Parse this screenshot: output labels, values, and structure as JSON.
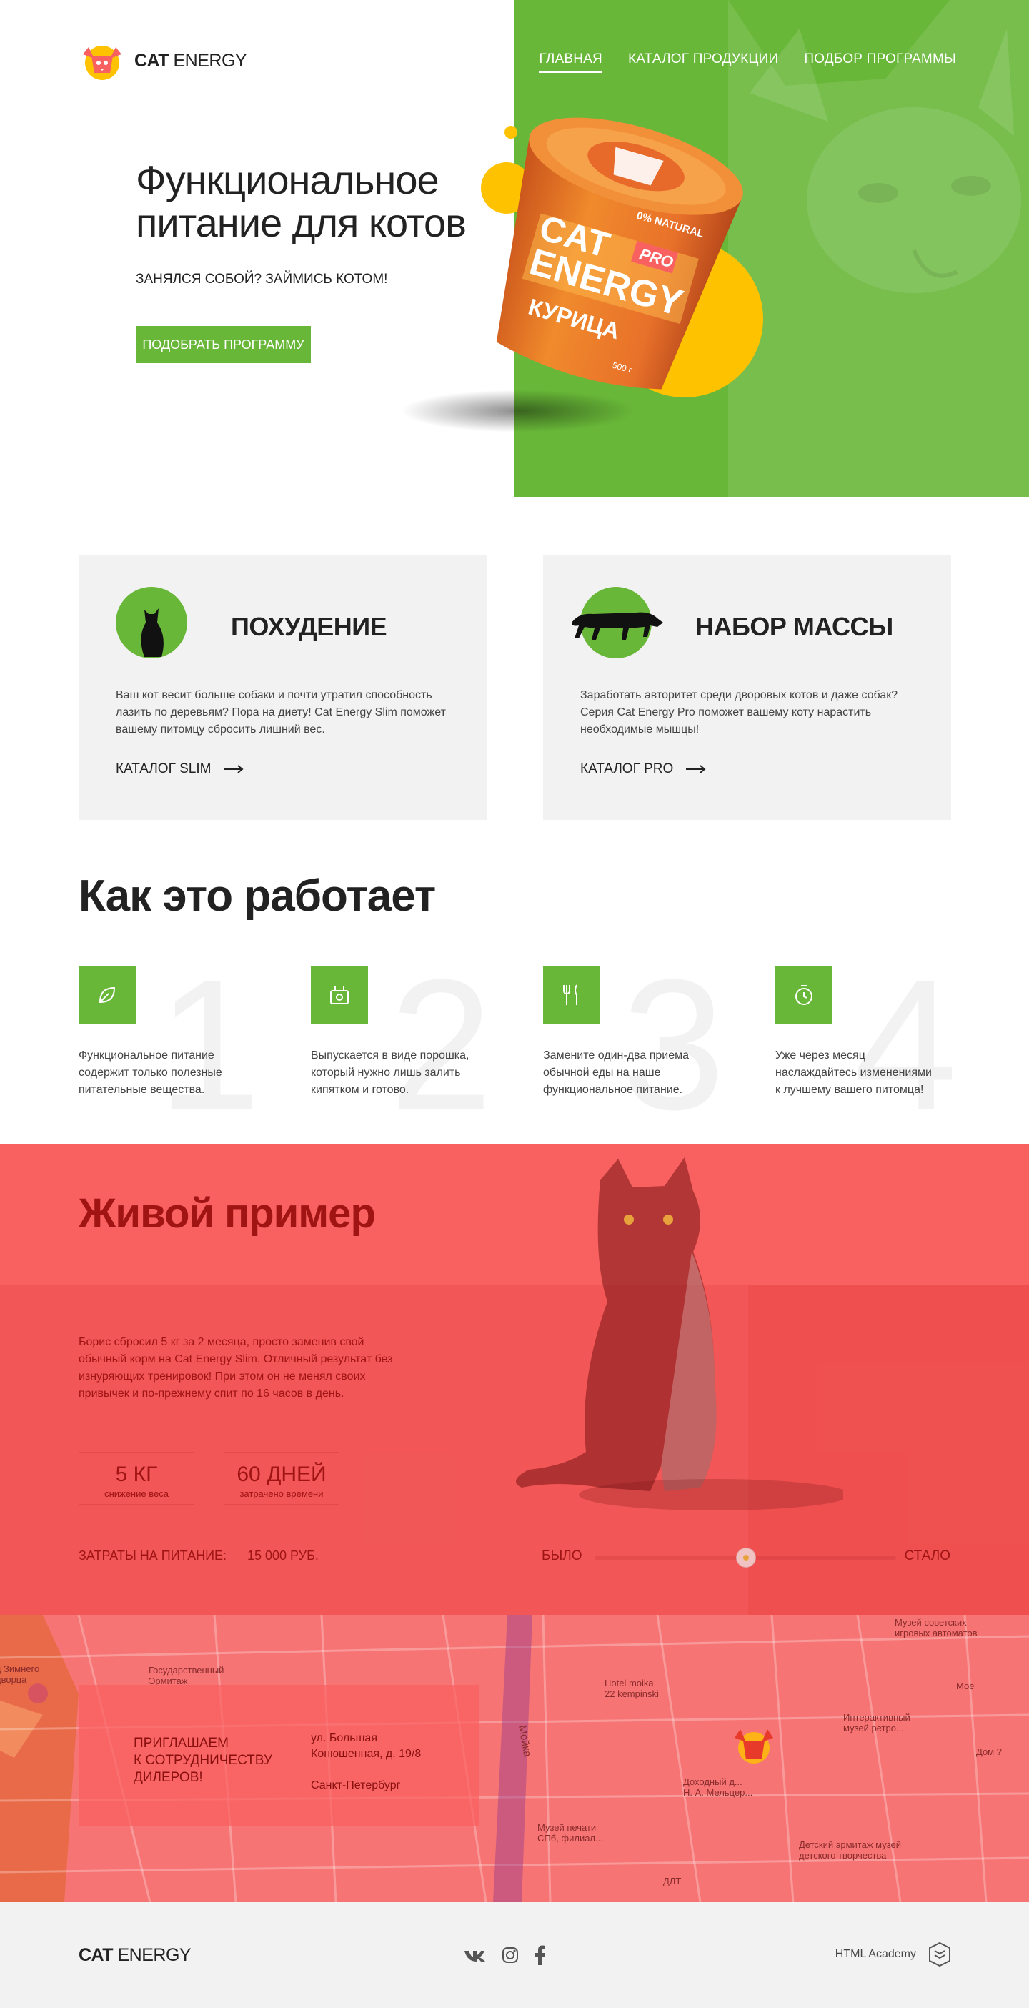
{
  "header": {
    "logo_bold": "CAT",
    "logo_light": "ENERGY",
    "nav": [
      "ГЛАВНАЯ",
      "КАТАЛОГ ПРОДУКЦИИ",
      "ПОДБОР ПРОГРАММЫ"
    ]
  },
  "hero": {
    "title_line1": "Функциональное",
    "title_line2": "питание для котов",
    "subtitle": "ЗАНЯЛСЯ СОБОЙ? ЗАЙМИСЬ КОТОМ!",
    "button": "ПОДОБРАТЬ ПРОГРАММУ",
    "can": {
      "natural": "0% NATURAL",
      "brand1": "CAT",
      "brand2": "ENERGY",
      "pro": "PRO",
      "flavor": "КУРИЦА",
      "weight": "500 г"
    }
  },
  "cards": [
    {
      "title": "ПОХУДЕНИЕ",
      "text": "Ваш кот весит больше собаки и почти утратил способность лазить по деревьям? Пора на диету! Cat Energy Slim поможет вашему питомцу сбросить лишний вес.",
      "link": "КАТАЛОГ SLIM"
    },
    {
      "title": "НАБОР МАССЫ",
      "text": "Заработать авторитет среди дворовых котов и даже собак? Серия Cat Energy Pro поможет вашему коту нарастить необходимые мышцы!",
      "link": "КАТАЛОГ PRO"
    }
  ],
  "how": {
    "title": "Как это работает",
    "steps": [
      {
        "num": "1",
        "icon": "leaf-icon",
        "text": "Функциональное питание содержит только полезные питательные вещества."
      },
      {
        "num": "2",
        "icon": "kettle-icon",
        "text": "Выпускается в виде порошка, который нужно лишь залить кипятком и готово."
      },
      {
        "num": "3",
        "icon": "cutlery-icon",
        "text": "Замените один-два приема обычной еды на наше функциональное питание."
      },
      {
        "num": "4",
        "icon": "timer-icon",
        "text": "Уже через месяц наслаждайтесь изменениями к лучшему вашего питомца!"
      }
    ]
  },
  "example": {
    "title": "Живой пример",
    "text": "Борис сбросил 5 кг за 2 месяца, просто заменив свой обычный корм на Cat Energy Slim. Отличный результат без изнуряющих тренировок! При этом он не менял своих привычек и по-прежнему спит по 16 часов в день.",
    "stats": [
      {
        "value": "5 КГ",
        "label": "снижение веса"
      },
      {
        "value": "60 ДНЕЙ",
        "label": "затрачено времени"
      }
    ],
    "cost_label": "ЗАТРАТЫ НА ПИТАНИЕ:",
    "cost_value": "15 000 РУБ.",
    "slider": {
      "before": "БЫЛО",
      "after": "СТАЛО",
      "position": 0.5
    }
  },
  "map": {
    "labels": {
      "winter_palace": "ц Зимнего\nдворца",
      "state_hermitage": "Государственный\nЭрмитаж",
      "hotel": "Hotel moika\n22 kempinski",
      "museum_soviet": "Музей советских\nигровых автоматов",
      "interactive": "Интерактивный\nмузей ретро...",
      "moika": "Мойка",
      "income_house": "Доходный д...\nН. А. Мельцер...",
      "print_museum": "Музей печати\nСПб, филиал...",
      "children_hermitage": "Детский эрмитаж музей\nдетского творчества",
      "dlt": "ДЛТ",
      "dom": "Дом ?",
      "moi": "Моё"
    },
    "card_title": "ПРИГЛАШАЕМ\nК СОТРУДНИЧЕСТВУ\nДИЛЕРОВ!",
    "address": "ул. Большая\nКонюшенная, д. 19/8",
    "city": "Санкт-Петербург"
  },
  "footer": {
    "logo_bold": "CAT",
    "logo_light": "ENERGY",
    "social": [
      "vk-icon",
      "instagram-icon",
      "facebook-icon"
    ],
    "academy": "HTML Academy"
  },
  "colors": {
    "green": "#68b738",
    "yellow": "#fec200",
    "red": "#f96060",
    "dark": "#222222",
    "gray": "#f2f2f2"
  }
}
